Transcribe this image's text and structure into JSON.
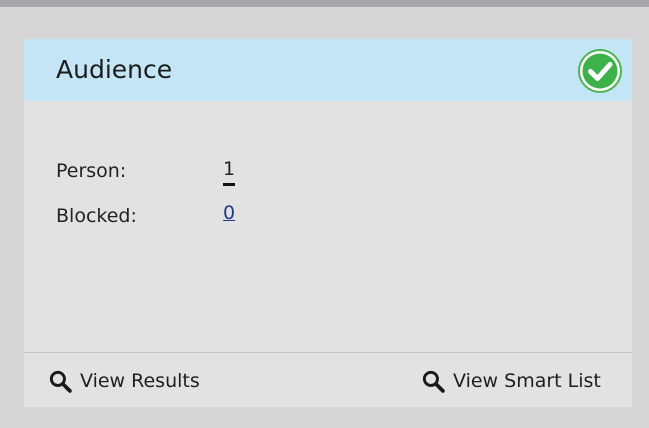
{
  "audience_card": {
    "title": "Audience",
    "status_icon": "check-circle-icon",
    "status_color": "#3db24a",
    "header_color": "#c4e5f6",
    "fields": {
      "person": {
        "label": "Person:",
        "value": "1"
      },
      "blocked": {
        "label": "Blocked:",
        "value": "0"
      }
    },
    "footer": {
      "view_results_label": "View Results",
      "view_results_icon": "magnifier-icon",
      "view_smart_list_label": "View Smart List",
      "view_smart_list_icon": "magnifier-icon"
    }
  }
}
